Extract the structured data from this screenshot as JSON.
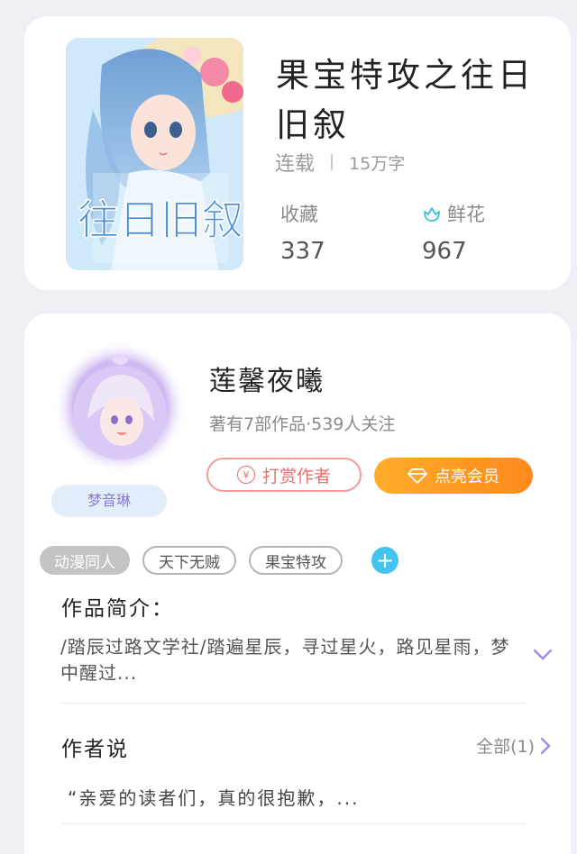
{
  "book": {
    "title": "果宝特攻之往日旧叙",
    "status": "连载",
    "word_count": "15万字",
    "stats": {
      "collect_label": "收藏",
      "collect_value": "337",
      "flower_label": "鲜花",
      "flower_value": "967"
    },
    "cover_text": "往日旧叙"
  },
  "author": {
    "name": "莲馨夜曦",
    "meta": "著有7部作品·539人关注",
    "avatar_badge": "梦音琳",
    "tip_button": "打赏作者",
    "tip_coin": "¥",
    "vip_button": "点亮会员"
  },
  "tags": [
    "动漫同人",
    "天下无贼",
    "果宝特攻"
  ],
  "intro": {
    "heading": "作品简介：",
    "text": "/踏辰过路文学社/踏遍星辰，寻过星火，路见星雨，梦中醒过..."
  },
  "author_say": {
    "heading": "作者说",
    "all_label": "全部(1)",
    "text": "“亲爱的读者们，真的很抱歉，..."
  },
  "colors": {
    "accent_orange": "#ff9a24",
    "tip_red": "#ef6d6d",
    "flower_teal": "#36bfe0",
    "chevron_purple": "#a38be6"
  }
}
